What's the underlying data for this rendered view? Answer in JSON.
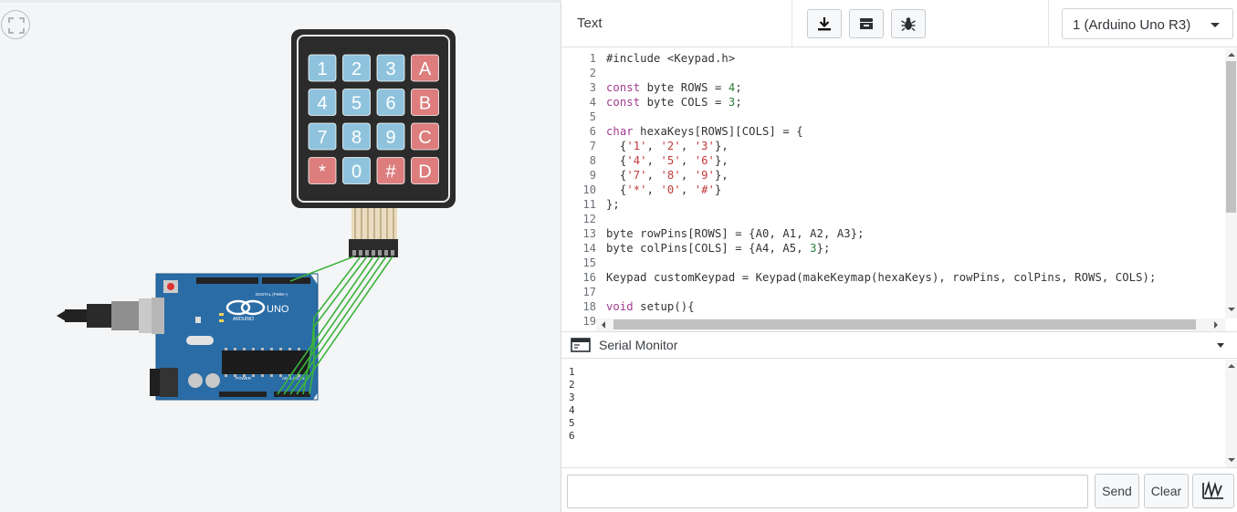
{
  "canvas": {
    "keypad_keys": [
      [
        "1",
        "2",
        "3",
        "A"
      ],
      [
        "4",
        "5",
        "6",
        "B"
      ],
      [
        "7",
        "8",
        "9",
        "C"
      ],
      [
        "*",
        "0",
        "#",
        "D"
      ]
    ],
    "board_label": "UNO",
    "board_brand": "ARDUINO",
    "digital_label": "DIGITAL (PWM~)",
    "power_label": "POWER",
    "analog_label": "ANALOG IN",
    "colors": {
      "keypad_body": "#2b2b2b",
      "key_blue": "#8fc3dd",
      "key_red": "#dd7d7d",
      "board_blue": "#2a6ca6",
      "wire_green": "#3bb33b"
    }
  },
  "toolbar": {
    "mode": "Text",
    "download_icon": "download-icon",
    "libraries_icon": "library-box-icon",
    "debug_icon": "bug-icon",
    "board_select_value": "1 (Arduino Uno R3)"
  },
  "editor": {
    "line_numbers": [
      "1",
      "2",
      "3",
      "4",
      "5",
      "6",
      "7",
      "8",
      "9",
      "10",
      "11",
      "12",
      "13",
      "14",
      "15",
      "16",
      "17",
      "18",
      "19"
    ],
    "lines": [
      "#include <Keypad.h>",
      "",
      "const byte ROWS = 4;",
      "const byte COLS = 3;",
      "",
      "char hexaKeys[ROWS][COLS] = {",
      "  {'1', '2', '3'},",
      "  {'4', '5', '6'},",
      "  {'7', '8', '9'},",
      "  {'*', '0', '#'}",
      "};",
      "",
      "byte rowPins[ROWS] = {A0, A1, A2, A3};",
      "byte colPins[COLS] = {A4, A5, 3};",
      "",
      "Keypad customKeypad = Keypad(makeKeymap(hexaKeys), rowPins, colPins, ROWS, COLS);",
      "",
      "void setup(){",
      ""
    ]
  },
  "serial": {
    "title": "Serial Monitor",
    "output": [
      "1",
      "2",
      "3",
      "4",
      "5",
      "6"
    ],
    "input_value": "",
    "send_label": "Send",
    "clear_label": "Clear",
    "graph_icon": "waveform-graph-icon"
  }
}
